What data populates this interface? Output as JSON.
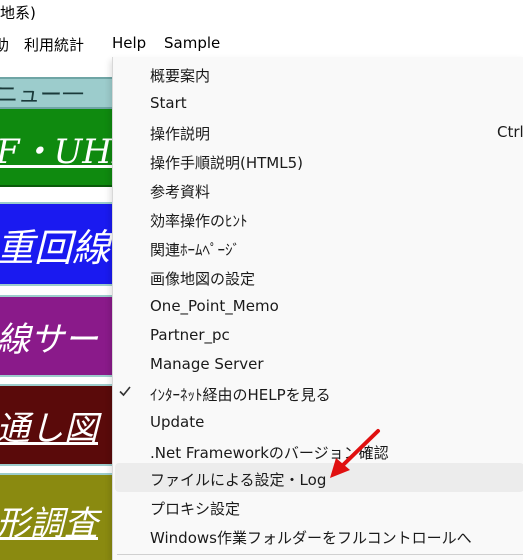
{
  "window": {
    "title_fragment": "地系)"
  },
  "menubar": {
    "items": [
      {
        "label": "助",
        "name": "menu-left-fragment"
      },
      {
        "label": "利用統計",
        "name": "menu-usage-stats"
      },
      {
        "label": "Help",
        "name": "menu-help"
      },
      {
        "label": "Sample",
        "name": "menu-sample"
      }
    ]
  },
  "panels": {
    "menu": "ニュー一",
    "green": "F・UHF回",
    "blue": "重回線",
    "purple": "線サー",
    "maroon": "通し図",
    "olive": "形調査"
  },
  "help_menu": {
    "items": [
      {
        "label": "概要案内"
      },
      {
        "label": "Start"
      },
      {
        "label": "操作説明",
        "shortcut": "Ctrl"
      },
      {
        "label": "操作手順説明(HTML5)"
      },
      {
        "label": "参考資料"
      },
      {
        "label": "効率操作のﾋﾝﾄ"
      },
      {
        "label": "関連ﾎｰﾑﾍﾟｰｼﾞ"
      },
      {
        "label": "画像地図の設定"
      },
      {
        "label": "One_Point_Memo"
      },
      {
        "label": "Partner_pc"
      },
      {
        "label": "Manage Server"
      },
      {
        "label": "ｲﾝﾀｰﾈｯﾄ経由のHELPを見る",
        "checked": true
      },
      {
        "label": "Update"
      },
      {
        "label": ".Net Frameworkのバージョン確認"
      },
      {
        "label": "ファイルによる設定・Log",
        "highlighted": true
      },
      {
        "label": "プロキシ設定"
      },
      {
        "label": "Windows作業フォルダーをフルコントロールへ"
      }
    ]
  },
  "colors": {
    "arrow": "#e01010",
    "menu_bg": "#f9f9f9",
    "highlight": "#ececec"
  }
}
